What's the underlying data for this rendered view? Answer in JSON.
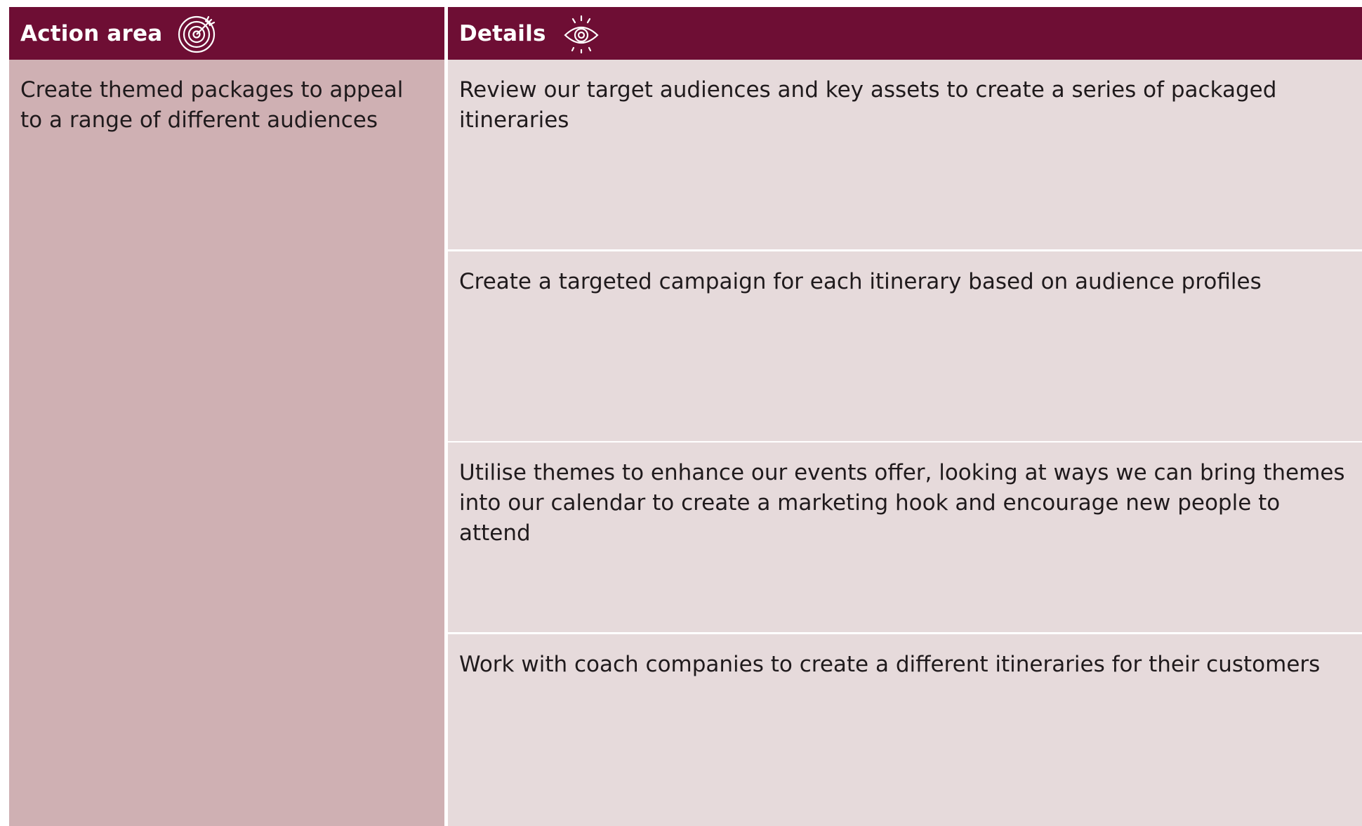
{
  "header": {
    "action_area_label": "Action area",
    "action_area_icon": "target-icon",
    "details_label": "Details",
    "details_icon": "eye-icon",
    "color": "#6e0e34"
  },
  "action_area": {
    "lines": [
      "Create themed packages to appeal",
      "to a range of different audiences"
    ]
  },
  "details": [
    {
      "lines": [
        "Review our target audiences and key assets to create a series of packaged",
        "itineraries"
      ]
    },
    {
      "lines": [
        "Create a targeted campaign for each itinerary based on audience profiles"
      ]
    },
    {
      "lines": [
        "Utilise themes to enhance our events offer, looking at ways we can bring themes",
        "into our calendar to create a marketing hook and encourage new people to",
        "attend"
      ]
    },
    {
      "lines": [
        "Work with coach companies to create a different itineraries for their customers"
      ]
    }
  ]
}
